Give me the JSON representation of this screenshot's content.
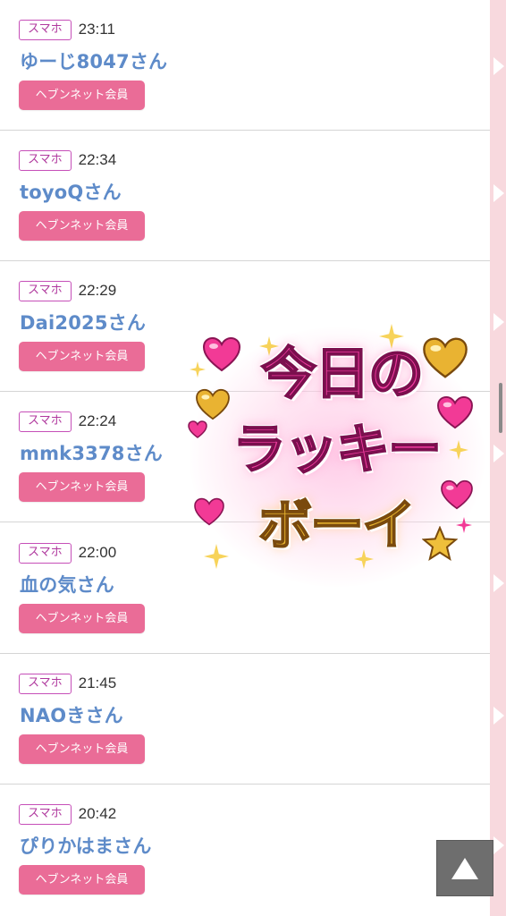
{
  "items": [
    {
      "device": "スマホ",
      "time": "23:11",
      "name": "ゆーじ8047さん",
      "membership": "ヘブンネット会員"
    },
    {
      "device": "スマホ",
      "time": "22:34",
      "name": "toyoQさん",
      "membership": "ヘブンネット会員"
    },
    {
      "device": "スマホ",
      "time": "22:29",
      "name": "Dai2025さん",
      "membership": "ヘブンネット会員"
    },
    {
      "device": "スマホ",
      "time": "22:24",
      "name": "mmk3378さん",
      "membership": "ヘブンネット会員"
    },
    {
      "device": "スマホ",
      "time": "22:00",
      "name": "血の気さん",
      "membership": "ヘブンネット会員"
    },
    {
      "device": "スマホ",
      "time": "21:45",
      "name": "NAOきさん",
      "membership": "ヘブンネット会員"
    },
    {
      "device": "スマホ",
      "time": "20:42",
      "name": "ぴりかはまさん",
      "membership": "ヘブンネット会員"
    }
  ],
  "lucky_stamp": {
    "line1": "今日の",
    "line2": "ラッキー",
    "line3": "ボーイ"
  },
  "colors": {
    "device_badge_border": "#c64fb8",
    "user_name": "#5e8bc9",
    "member_badge_bg": "#ea6c97",
    "side_strip": "#f8d9de",
    "top_button_bg": "#6e6e6e"
  },
  "icons": {
    "scroll_top": "triangle-up-icon",
    "hearts": "heart-icon",
    "sparkles": "sparkle-icon"
  }
}
